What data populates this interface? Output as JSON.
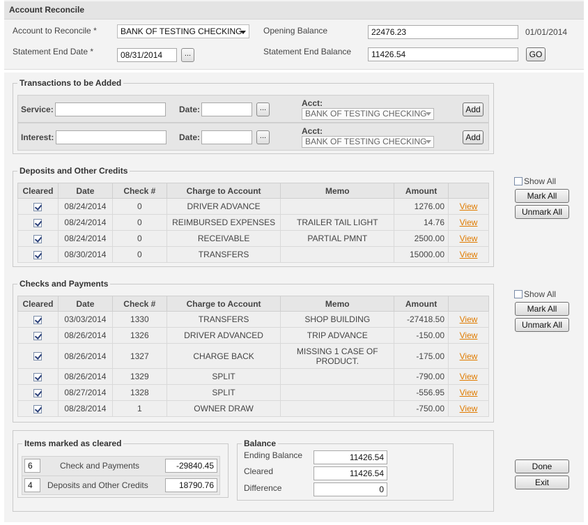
{
  "header": {
    "title": "Account Reconcile"
  },
  "account": {
    "account_label": "Account to Reconcile *",
    "account_value": "BANK OF TESTING CHECKING",
    "end_date_label": "Statement End Date *",
    "end_date_value": "08/31/2014",
    "opening_label": "Opening Balance",
    "opening_value": "22476.23",
    "opening_date": "01/01/2014",
    "end_balance_label": "Statement End Balance",
    "end_balance_value": "11426.54",
    "go_label": "GO",
    "picker_label": "..."
  },
  "transactions": {
    "legend": "Transactions to be Added",
    "service_label": "Service:",
    "interest_label": "Interest:",
    "date_label": "Date:",
    "acct_label": "Acct:",
    "acct_value": "BANK OF TESTING CHECKING",
    "add_label": "Add",
    "picker_label": "..."
  },
  "deposits": {
    "legend": "Deposits and Other Credits",
    "show_all": "Show All",
    "mark_all": "Mark All",
    "unmark_all": "Unmark All",
    "columns": [
      "Cleared",
      "Date",
      "Check #",
      "Charge to Account",
      "Memo",
      "Amount",
      ""
    ],
    "rows": [
      {
        "date": "08/24/2014",
        "check": "0",
        "account": "DRIVER ADVANCE",
        "memo": "",
        "amount": "1276.00",
        "link": "View"
      },
      {
        "date": "08/24/2014",
        "check": "0",
        "account": "REIMBURSED EXPENSES",
        "memo": "TRAILER TAIL LIGHT",
        "amount": "14.76",
        "link": "View"
      },
      {
        "date": "08/24/2014",
        "check": "0",
        "account": "RECEIVABLE",
        "memo": "PARTIAL PMNT",
        "amount": "2500.00",
        "link": "View"
      },
      {
        "date": "08/30/2014",
        "check": "0",
        "account": "TRANSFERS",
        "memo": "",
        "amount": "15000.00",
        "link": "View"
      }
    ]
  },
  "checks": {
    "legend": "Checks and Payments",
    "show_all": "Show All",
    "mark_all": "Mark All",
    "unmark_all": "Unmark All",
    "columns": [
      "Cleared",
      "Date",
      "Check #",
      "Charge to Account",
      "Memo",
      "Amount",
      ""
    ],
    "rows": [
      {
        "date": "03/03/2014",
        "check": "1330",
        "account": "TRANSFERS",
        "memo": "SHOP BUILDING",
        "amount": "-27418.50",
        "link": "View"
      },
      {
        "date": "08/26/2014",
        "check": "1326",
        "account": "DRIVER ADVANCED",
        "memo": "TRIP ADVANCE",
        "amount": "-150.00",
        "link": "View"
      },
      {
        "date": "08/26/2014",
        "check": "1327",
        "account": "CHARGE BACK",
        "memo": "MISSING 1 CASE OF PRODUCT.",
        "amount": "-175.00",
        "link": "View"
      },
      {
        "date": "08/26/2014",
        "check": "1329",
        "account": "SPLIT",
        "memo": "",
        "amount": "-790.00",
        "link": "View"
      },
      {
        "date": "08/27/2014",
        "check": "1328",
        "account": "SPLIT",
        "memo": "",
        "amount": "-556.95",
        "link": "View"
      },
      {
        "date": "08/28/2014",
        "check": "1",
        "account": "OWNER DRAW",
        "memo": "",
        "amount": "-750.00",
        "link": "View"
      }
    ]
  },
  "cleared": {
    "legend": "Items marked as cleared",
    "rows": [
      {
        "count": "6",
        "label": "Check and Payments",
        "value": "-29840.45"
      },
      {
        "count": "4",
        "label": "Deposits and Other Credits",
        "value": "18790.76"
      }
    ]
  },
  "balance": {
    "legend": "Balance",
    "ending_label": "Ending Balance",
    "ending_value": "11426.54",
    "cleared_label": "Cleared",
    "cleared_value": "11426.54",
    "difference_label": "Difference",
    "difference_value": "0"
  },
  "actions": {
    "done": "Done",
    "exit": "Exit"
  }
}
